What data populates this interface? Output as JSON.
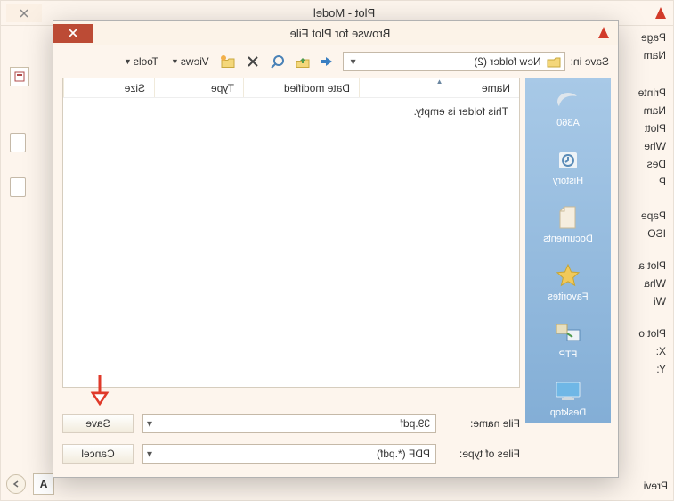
{
  "outer": {
    "title": "Plot - Model",
    "labels": [
      "Page",
      "Nam",
      "Printe",
      "Nam",
      "Plott",
      "Whe",
      "Des",
      "P",
      "Pape",
      "ISO",
      "Plot a",
      "Wha",
      "Wi",
      "Plot o",
      "X:",
      "Y:",
      "Previ"
    ]
  },
  "browse": {
    "title": "Browse for Plot File",
    "saveInLabel": "Save in:",
    "saveInValue": "New folder (2)",
    "viewsLabel": "Views",
    "toolsLabel": "Tools",
    "columns": {
      "name": "Name",
      "date": "Date modified",
      "type": "Type",
      "size": "Size"
    },
    "emptyMessage": "This folder is empty.",
    "fileNameLabel": "File name:",
    "fileNameValue": "39.pdf",
    "fileTypeLabel": "Files of type:",
    "fileTypeValue": "PDF (*.pdf)",
    "saveBtn": "Save",
    "cancelBtn": "Cancel",
    "places": [
      {
        "name": "A360"
      },
      {
        "name": "History"
      },
      {
        "name": "Documents"
      },
      {
        "name": "Favorites"
      },
      {
        "name": "FTP"
      },
      {
        "name": "Desktop"
      }
    ]
  }
}
